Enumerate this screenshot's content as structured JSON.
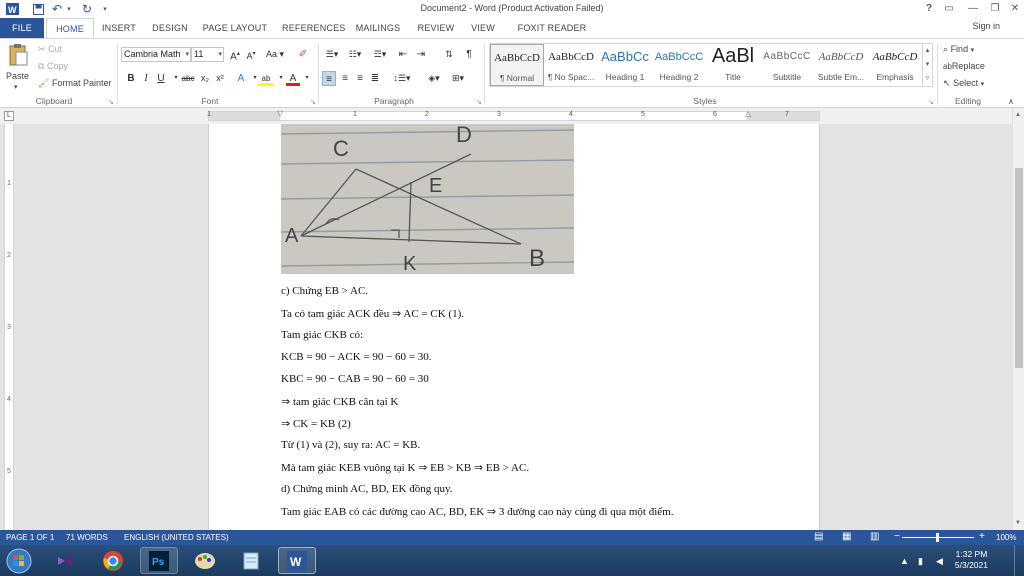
{
  "titlebar": {
    "title": "Document2 - Word (Product Activation Failed)",
    "help": "?",
    "undo_arrow": "▾",
    "customize_arrow": "▾"
  },
  "tabs": {
    "file": "FILE",
    "items": [
      "HOME",
      "INSERT",
      "DESIGN",
      "PAGE LAYOUT",
      "REFERENCES",
      "MAILINGS",
      "REVIEW",
      "VIEW",
      "FOXIT READER PDF"
    ],
    "sign_in": "Sign in"
  },
  "ribbon": {
    "clipboard": {
      "label": "Clipboard",
      "paste": "Paste",
      "cut": "Cut",
      "copy": "Copy",
      "format_painter": "Format Painter"
    },
    "font": {
      "label": "Font",
      "font_name": "Cambria Math",
      "font_size": "11",
      "bold": "B",
      "italic": "I",
      "underline": "U",
      "strike": "abc",
      "sub": "x₂",
      "sup": "x²",
      "grow": "A",
      "shrink": "A",
      "case": "Aa",
      "font_color": "A",
      "highlight": "ab"
    },
    "paragraph": {
      "label": "Paragraph",
      "pilcrow": "¶"
    },
    "styles": {
      "label": "Styles",
      "items": [
        {
          "sample": "AaBbCcD",
          "name": "¶ Normal"
        },
        {
          "sample": "AaBbCcD",
          "name": "¶ No Spac..."
        },
        {
          "sample": "AaBbCc",
          "name": "Heading 1"
        },
        {
          "sample": "AaBbCcC",
          "name": "Heading 2"
        },
        {
          "sample": "AaBl",
          "name": "Title"
        },
        {
          "sample": "AaBbCcC",
          "name": "Subtitle"
        },
        {
          "sample": "AaBbCcD",
          "name": "Subtle Em..."
        },
        {
          "sample": "AaBbCcD",
          "name": "Emphasis"
        }
      ]
    },
    "editing": {
      "label": "Editing",
      "find": "Find",
      "replace": "Replace",
      "select": "Select"
    }
  },
  "ruler": {
    "numbers": [
      "1",
      "1",
      "2",
      "3",
      "4",
      "5",
      "6",
      "7"
    ],
    "corner": "L",
    "vertical_numbers": [
      "1",
      "2",
      "3",
      "4",
      "5"
    ]
  },
  "document": {
    "photo_labels": [
      "C",
      "D",
      "E",
      "A",
      "K",
      "B"
    ],
    "lines": [
      "c) Chứng EB > AC.",
      "Ta có tam giác ACK đều ⇒ AC = CK (1).",
      "Tam giác CKB có:",
      "KCB = 90 − ACK = 90 − 60 = 30.",
      "KBC = 90 − CAB = 90 − 60 = 30",
      "⇒ tam giác CKB cân tại K",
      "⇒ CK = KB (2)",
      "Từ (1) và (2), suy ra: AC = KB.",
      "Mà tam giác KEB vuông tại K ⇒ EB > KB ⇒ EB > AC.",
      "d) Chứng minh AC, BD, EK đồng quy.",
      "Tam giác EAB có các đường cao AC, BD, EK ⇒ 3 đường cao này cùng đi qua một điểm."
    ]
  },
  "statusbar": {
    "page": "PAGE 1 OF 1",
    "words": "71 WORDS",
    "language": "ENGLISH (UNITED STATES)",
    "zoom": "100%",
    "zoom_minus": "−",
    "zoom_plus": "+"
  },
  "taskbar": {
    "time": "1:32 PM",
    "date": "5/3/2021"
  },
  "colors": {
    "accent": "#2b579a",
    "taskbar": "#1b3a5e"
  }
}
